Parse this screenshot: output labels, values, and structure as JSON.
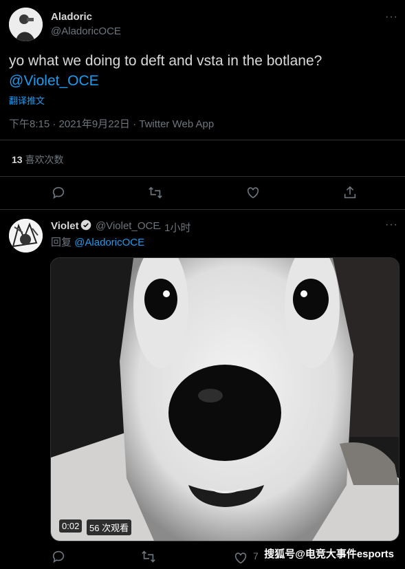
{
  "tweet": {
    "author_name": "Aladoric",
    "author_handle": "@AladoricOCE",
    "text": "yo what we doing to deft and vsta in the botlane?",
    "mention": "@Violet_OCE",
    "translate": "翻译推文",
    "timestamp": "下午8:15 · 2021年9月22日 · Twitter Web App",
    "likes_count": "13",
    "likes_label": "喜欢次数",
    "more": "···"
  },
  "reply": {
    "author_name": "Violet",
    "author_handle": "@Violet_OCE",
    "time": "· 1小时",
    "reply_prefix": "回复",
    "reply_to": "@AladoricOCE",
    "more": "···",
    "video_time": "0:02",
    "video_views": "56 次观看",
    "like_count_partial": "7"
  },
  "watermark": "搜狐号@电竞大事件esports",
  "colors": {
    "background": "#000000",
    "text": "#d9d9d9",
    "muted": "#6e767d",
    "link": "#1d9bf0",
    "divider": "#2f3336"
  },
  "icons": [
    "reply-icon",
    "retweet-icon",
    "like-icon",
    "share-icon",
    "verified-icon",
    "more-icon"
  ]
}
